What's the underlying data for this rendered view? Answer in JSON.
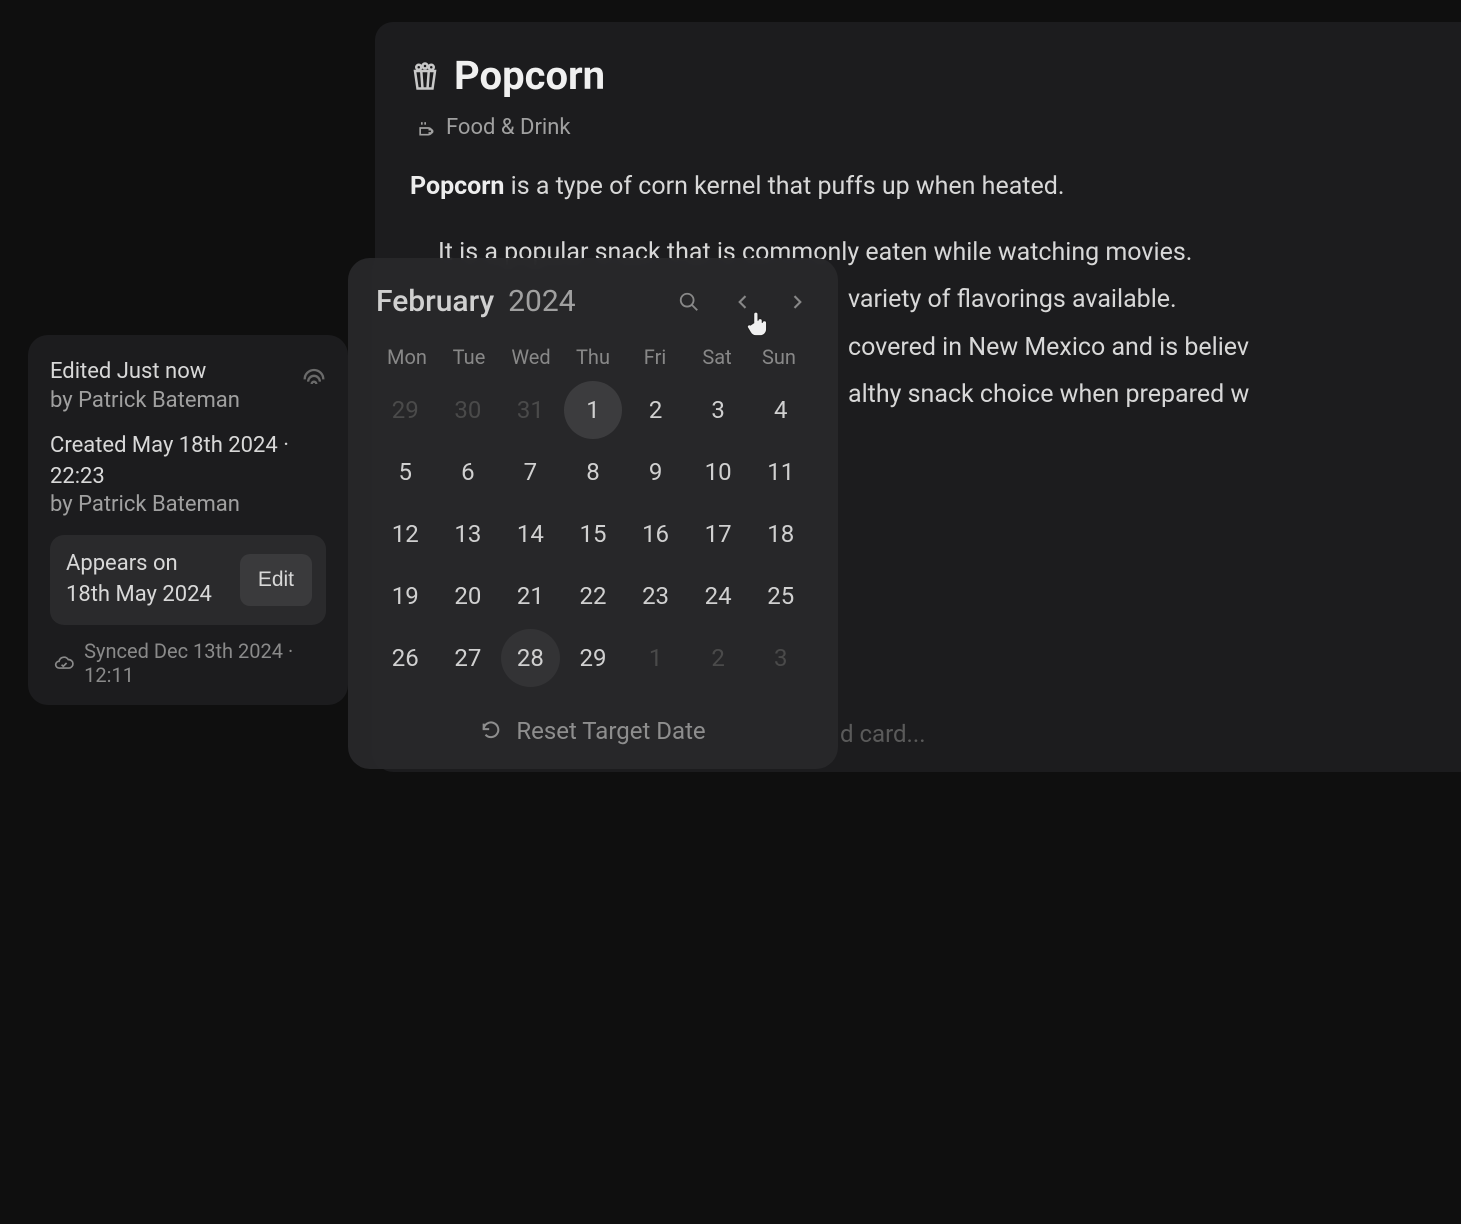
{
  "content": {
    "title": "Popcorn",
    "category": "Food & Drink",
    "description_bold": "Popcorn",
    "description_rest": " is a type of corn kernel that puffs up when heated.",
    "bullets": [
      "It is a popular snack that is commonly eaten while watching movies.",
      "variety of flavorings available.",
      "covered in New Mexico and is believ",
      "",
      "althy snack choice when prepared w"
    ],
    "add_card_hint": "d card..."
  },
  "meta": {
    "edited_line": "Edited Just now",
    "edited_by": "by Patrick Bateman",
    "created_line": "Created May 18th 2024 · 22:23",
    "created_by": "by Patrick Bateman",
    "appears_label": "Appears on",
    "appears_date": "18th May 2024",
    "edit_label": "Edit",
    "synced": "Synced Dec 13th 2024 · 12:11"
  },
  "picker": {
    "month": "February",
    "year": "2024",
    "dow": [
      "Mon",
      "Tue",
      "Wed",
      "Thu",
      "Fri",
      "Sat",
      "Sun"
    ],
    "weeks": [
      [
        {
          "n": "29",
          "o": true
        },
        {
          "n": "30",
          "o": true
        },
        {
          "n": "31",
          "o": true
        },
        {
          "n": "1",
          "today": true
        },
        {
          "n": "2"
        },
        {
          "n": "3"
        },
        {
          "n": "4"
        }
      ],
      [
        {
          "n": "5"
        },
        {
          "n": "6"
        },
        {
          "n": "7"
        },
        {
          "n": "8"
        },
        {
          "n": "9"
        },
        {
          "n": "10"
        },
        {
          "n": "11"
        }
      ],
      [
        {
          "n": "12"
        },
        {
          "n": "13"
        },
        {
          "n": "14"
        },
        {
          "n": "15"
        },
        {
          "n": "16"
        },
        {
          "n": "17"
        },
        {
          "n": "18"
        }
      ],
      [
        {
          "n": "19"
        },
        {
          "n": "20"
        },
        {
          "n": "21"
        },
        {
          "n": "22"
        },
        {
          "n": "23"
        },
        {
          "n": "24"
        },
        {
          "n": "25"
        }
      ],
      [
        {
          "n": "26"
        },
        {
          "n": "27"
        },
        {
          "n": "28",
          "sel": true
        },
        {
          "n": "29"
        },
        {
          "n": "1",
          "o": true
        },
        {
          "n": "2",
          "o": true
        },
        {
          "n": "3",
          "o": true
        }
      ]
    ],
    "reset": "Reset Target Date"
  }
}
